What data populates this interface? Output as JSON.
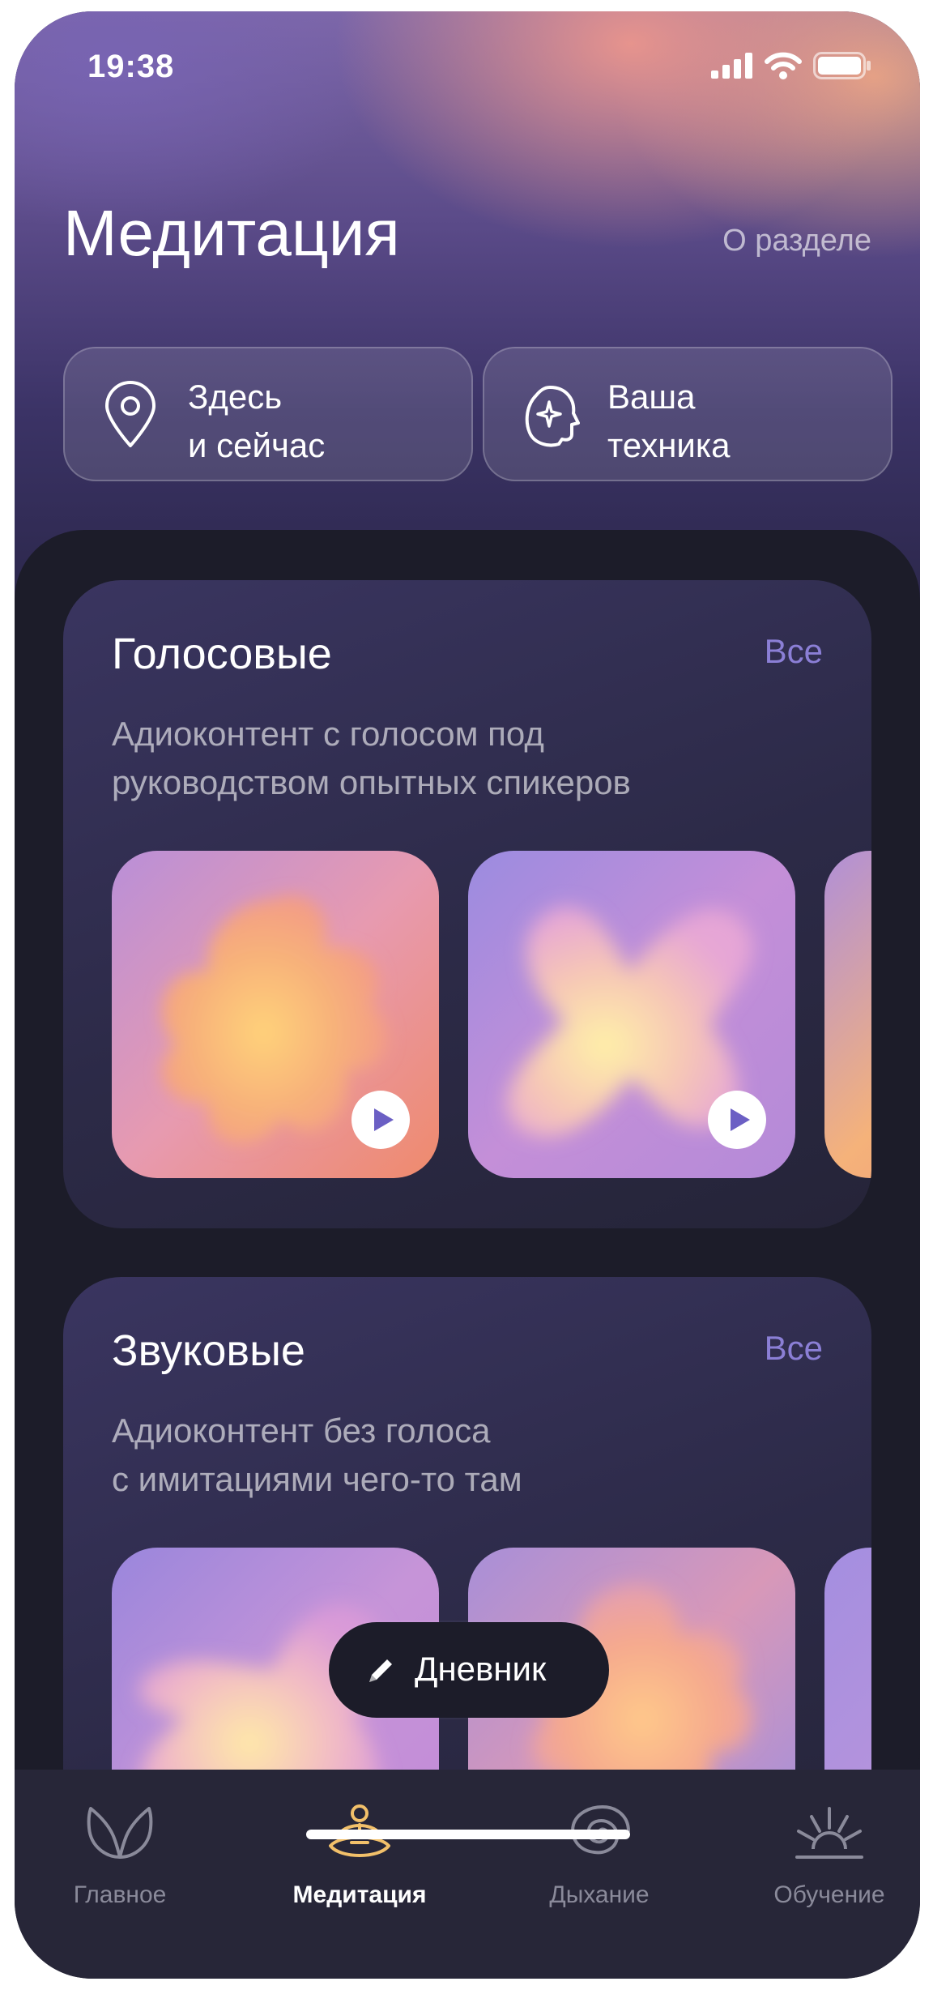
{
  "status_bar": {
    "time": "19:38",
    "icons": [
      "cellular-signal-icon",
      "wifi-icon",
      "battery-icon"
    ]
  },
  "header": {
    "title": "Медитация",
    "about_link": "О разделе"
  },
  "quick_actions": [
    {
      "line1": "Здесь",
      "line2": "и сейчас",
      "icon": "location-pin-icon"
    },
    {
      "line1": "Ваша",
      "line2": "техника",
      "icon": "sparkle-head-icon"
    }
  ],
  "sections": [
    {
      "title": "Голосовые",
      "all_label": "Все",
      "desc_line1": "Адиоконтент с голосом под",
      "desc_line2": "руководством опытных спикеров"
    },
    {
      "title": "Звуковые",
      "all_label": "Все",
      "desc_line1": "Адиоконтент без голоса",
      "desc_line2": "с имитациями чего-то там"
    }
  ],
  "diary_button": {
    "label": "Дневник",
    "icon": "pencil-icon"
  },
  "tab_bar": [
    {
      "label": "Главное",
      "icon": "hands-icon",
      "active": false
    },
    {
      "label": "Медитация",
      "icon": "meditation-icon",
      "active": true
    },
    {
      "label": "Дыхание",
      "icon": "spiral-icon",
      "active": false
    },
    {
      "label": "Обучение",
      "icon": "sunrise-icon",
      "active": false
    }
  ],
  "colors": {
    "accent": "#8b7fd6",
    "background": "#1c1c29",
    "card": "#2c2a47",
    "active_icon": "#f2c06a"
  }
}
